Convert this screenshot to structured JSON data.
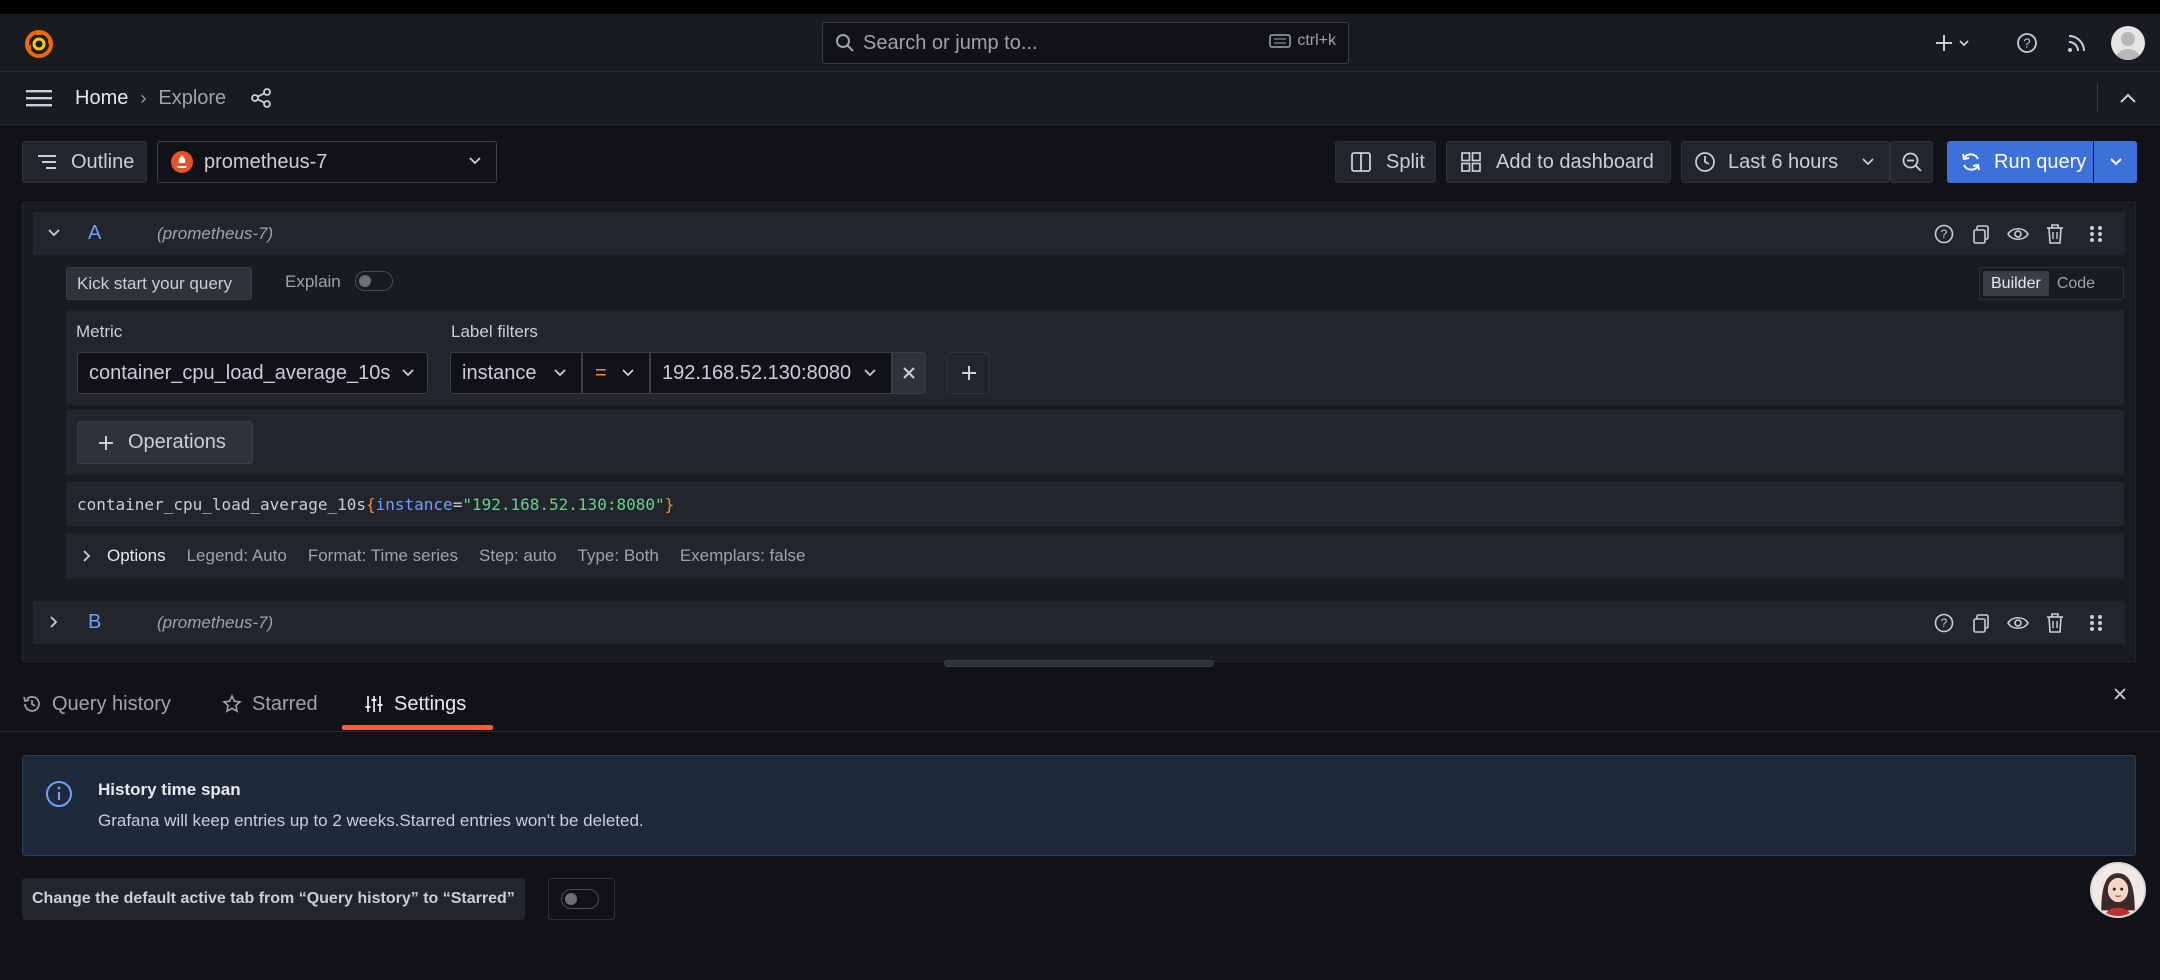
{
  "topbar": {
    "search_placeholder": "Search or jump to...",
    "search_shortcut": "ctrl+k"
  },
  "breadcrumb": {
    "home": "Home",
    "current": "Explore"
  },
  "toolbar": {
    "outline_label": "Outline",
    "datasource": "prometheus-7",
    "split_label": "Split",
    "add_to_dashboard_label": "Add to dashboard",
    "time_range": "Last 6 hours",
    "run_query_label": "Run query"
  },
  "query_a": {
    "ref": "A",
    "datasource": "(prometheus-7)",
    "kick_start_label": "Kick start your query",
    "explain_label": "Explain",
    "builder_label": "Builder",
    "code_label": "Code",
    "metric_heading": "Metric",
    "metric_value": "container_cpu_load_average_10s",
    "label_filters_heading": "Label filters",
    "label_key": "instance",
    "label_op": "=",
    "label_value": "192.168.52.130:8080",
    "operations_label": "Operations",
    "promql": {
      "metric": "container_cpu_load_average_10s",
      "open": "{",
      "key": "instance",
      "eq": "=",
      "value": "\"192.168.52.130:8080\"",
      "close": "}"
    },
    "options": {
      "label": "Options",
      "legend": "Legend: Auto",
      "format": "Format: Time series",
      "step": "Step: auto",
      "type": "Type: Both",
      "exemplars": "Exemplars: false"
    }
  },
  "query_b": {
    "ref": "B",
    "datasource": "(prometheus-7)"
  },
  "drawer": {
    "tabs": [
      "Query history",
      "Starred",
      "Settings"
    ],
    "active_tab": "Settings",
    "alert_title": "History time span",
    "alert_body": "Grafana will keep entries up to 2 weeks.Starred entries won't be deleted.",
    "setting_label": "Change the default active tab from “Query history” to “Starred”"
  },
  "colors": {
    "accent_blue": "#3d71d9",
    "brand_orange": "#f55f3e",
    "query_ref_blue": "#6e9fff",
    "promql_green": "#6ccf8e"
  }
}
